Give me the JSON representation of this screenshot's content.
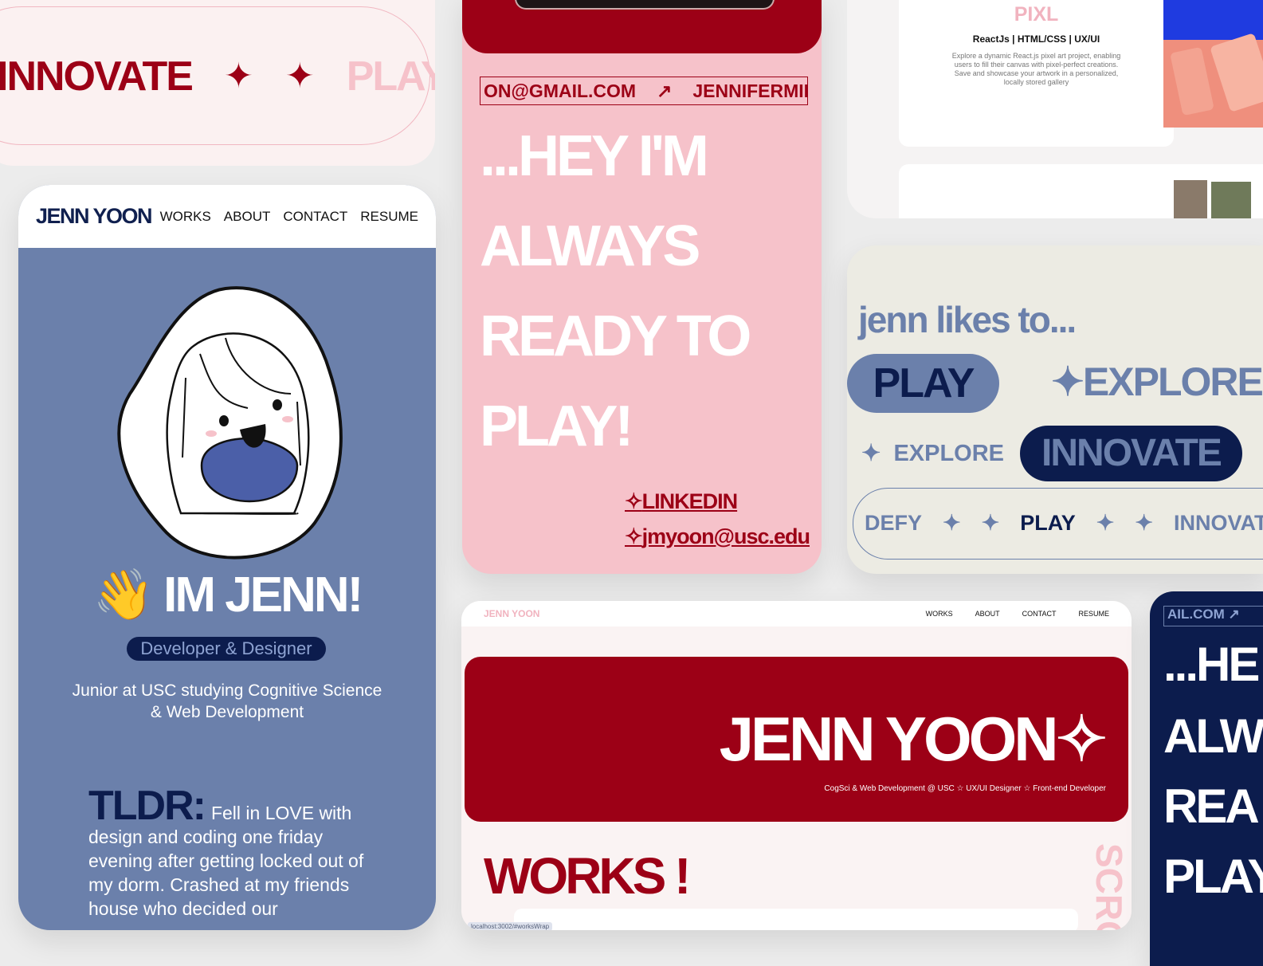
{
  "card_a": {
    "words": [
      "INNOVATE",
      "PLAY"
    ],
    "star": "✦"
  },
  "mobile": {
    "brand": "JENN YOON",
    "nav": [
      "WORKS",
      "ABOUT",
      "CONTACT",
      "RESUME"
    ],
    "greeting_emoji": "👋",
    "greeting": "IM JENN!",
    "role_badge": "Developer & Designer",
    "bio": "Junior at USC studying Cognitive Science & Web Development",
    "tldr_label": "TLDR:",
    "tldr_text": "Fell in LOVE with design and coding one friday evening after getting locked out of my dorm. Crashed at my friends house who decided our"
  },
  "pink": {
    "marquee": [
      "ON@GMAIL.COM",
      "↗",
      "JENNIFERMINAHYO"
    ],
    "headline": [
      "...HEY I'M",
      "ALWAYS",
      "READY TO",
      "PLAY!"
    ],
    "links": [
      {
        "icon": "✧",
        "label": "LINKEDIN"
      },
      {
        "icon": "✧",
        "label": "jmyoon@usc.edu"
      }
    ]
  },
  "project": {
    "title": "PIXL",
    "tags": "ReactJs | HTML/CSS | UX/UI",
    "description": "Explore a dynamic React.js pixel art project, enabling users to fill their canvas with pixel-perfect creations. Save and showcase your artwork in a personalized, locally stored gallery"
  },
  "likes": {
    "title": "jenn likes to...",
    "pills": [
      "PLAY",
      "✦EXPLORE✦",
      "EXPLORE",
      "INNOVATE"
    ],
    "ring": [
      "DEFY",
      "✦",
      "✦",
      "PLAY",
      "✦",
      "✦",
      "INNOVAT"
    ]
  },
  "desktop": {
    "brand": "JENN YOON",
    "nav": [
      "WORKS",
      "ABOUT",
      "CONTACT",
      "RESUME"
    ],
    "hero_name": "JENN YOON✧",
    "hero_sub": "CogSci & Web Development @ USC ☆ UX/UI Designer ☆ Front-end Developer",
    "section": "WORKS !",
    "scroll_text": "SCRO",
    "url_hint": "localhost:3002/#worksWrap"
  },
  "dark": {
    "marquee": "AIL.COM ↗",
    "headline": [
      "...HE",
      "ALW",
      "REA",
      "PLAY"
    ]
  },
  "colors": {
    "red": "#9c0016",
    "pink": "#f6c2ca",
    "blue": "#6b80ab",
    "navy": "#0c1c4d",
    "beige": "#ecebe3"
  }
}
